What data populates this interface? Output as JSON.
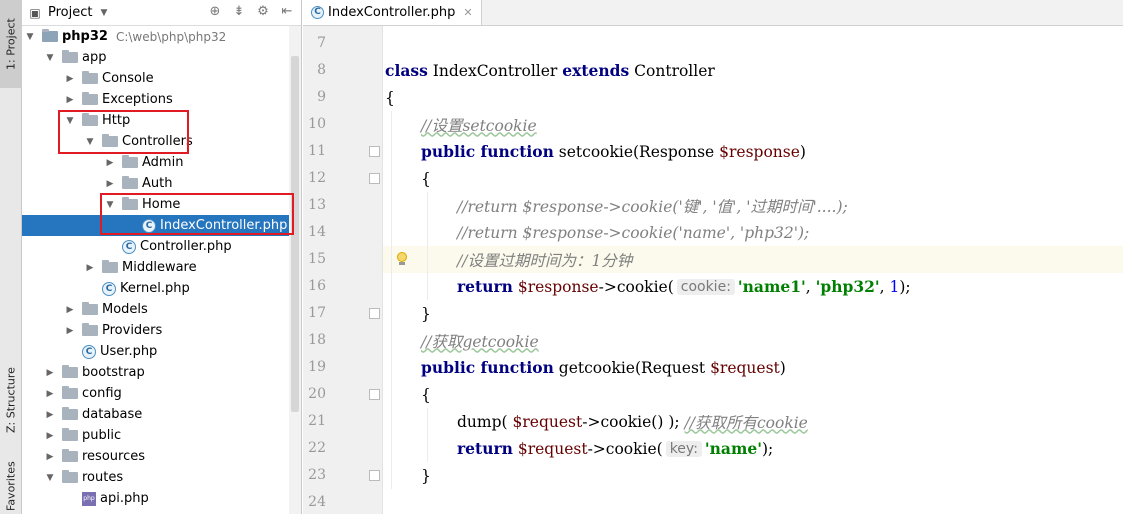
{
  "side_strip": {
    "project_tab": "1: Project",
    "structure_tab": "Z: Structure",
    "favorites_tab": "Favorites"
  },
  "project_panel": {
    "title": "Project",
    "tree": [
      {
        "label": "php32",
        "path": "C:\\web\\php\\php32",
        "depth": 0,
        "expanded": true,
        "kind": "project-folder",
        "bold": true
      },
      {
        "label": "app",
        "depth": 1,
        "expanded": true,
        "kind": "folder"
      },
      {
        "label": "Console",
        "depth": 2,
        "expanded": false,
        "kind": "folder"
      },
      {
        "label": "Exceptions",
        "depth": 2,
        "expanded": false,
        "kind": "folder"
      },
      {
        "label": "Http",
        "depth": 2,
        "expanded": true,
        "kind": "folder"
      },
      {
        "label": "Controllers",
        "depth": 3,
        "expanded": true,
        "kind": "folder"
      },
      {
        "label": "Admin",
        "depth": 4,
        "expanded": false,
        "kind": "folder"
      },
      {
        "label": "Auth",
        "depth": 4,
        "expanded": false,
        "kind": "folder"
      },
      {
        "label": "Home",
        "depth": 4,
        "expanded": true,
        "kind": "folder"
      },
      {
        "label": "IndexController.php",
        "depth": 5,
        "kind": "class",
        "selected": true
      },
      {
        "label": "Controller.php",
        "depth": 4,
        "kind": "class"
      },
      {
        "label": "Middleware",
        "depth": 3,
        "expanded": false,
        "kind": "folder"
      },
      {
        "label": "Kernel.php",
        "depth": 3,
        "kind": "class"
      },
      {
        "label": "Models",
        "depth": 2,
        "expanded": false,
        "kind": "folder"
      },
      {
        "label": "Providers",
        "depth": 2,
        "expanded": false,
        "kind": "folder"
      },
      {
        "label": "User.php",
        "depth": 2,
        "kind": "class"
      },
      {
        "label": "bootstrap",
        "depth": 1,
        "expanded": false,
        "kind": "folder"
      },
      {
        "label": "config",
        "depth": 1,
        "expanded": false,
        "kind": "folder"
      },
      {
        "label": "database",
        "depth": 1,
        "expanded": false,
        "kind": "folder"
      },
      {
        "label": "public",
        "depth": 1,
        "expanded": false,
        "kind": "folder"
      },
      {
        "label": "resources",
        "depth": 1,
        "expanded": false,
        "kind": "folder"
      },
      {
        "label": "routes",
        "depth": 1,
        "expanded": true,
        "kind": "folder"
      },
      {
        "label": "api.php",
        "depth": 2,
        "kind": "php"
      }
    ]
  },
  "editor": {
    "active_tab": "IndexController.php",
    "lines": [
      {
        "num": "7",
        "indent": 0,
        "tokens": []
      },
      {
        "num": "8",
        "indent": 0,
        "tokens": [
          [
            "kw",
            "class"
          ],
          [
            "plain",
            " IndexController "
          ],
          [
            "kw",
            "extends"
          ],
          [
            "plain",
            " Controller"
          ]
        ]
      },
      {
        "num": "9",
        "indent": 0,
        "tokens": [
          [
            "plain",
            "{"
          ]
        ]
      },
      {
        "num": "10",
        "indent": 1,
        "tokens": [
          [
            "cmt",
            "//设置setcookie"
          ]
        ]
      },
      {
        "num": "11",
        "indent": 1,
        "tokens": [
          [
            "kw",
            "public function"
          ],
          [
            "plain",
            " setcookie(Response "
          ],
          [
            "var",
            "$response"
          ],
          [
            "plain",
            ")"
          ]
        ]
      },
      {
        "num": "12",
        "indent": 1,
        "tokens": [
          [
            "plain",
            "{"
          ]
        ]
      },
      {
        "num": "13",
        "indent": 2,
        "tokens": [
          [
            "cmt",
            "//return $response->cookie('键', '值', '过期时间'....);"
          ]
        ]
      },
      {
        "num": "14",
        "indent": 2,
        "tokens": [
          [
            "cmt",
            "//return $response->cookie('name', 'php32');"
          ]
        ]
      },
      {
        "num": "15",
        "indent": 2,
        "current": true,
        "tokens": [
          [
            "cmt",
            "//设置过期时间为：1分钟"
          ]
        ]
      },
      {
        "num": "16",
        "indent": 2,
        "tokens": [
          [
            "kw",
            "return"
          ],
          [
            "plain",
            " "
          ],
          [
            "var",
            "$response"
          ],
          [
            "plain",
            "->cookie("
          ],
          [
            "hint",
            "cookie:"
          ],
          [
            "str",
            "'name1'"
          ],
          [
            "plain",
            ", "
          ],
          [
            "str",
            "'php32'"
          ],
          [
            "plain",
            ", "
          ],
          [
            "num",
            "1"
          ],
          [
            "plain",
            ");"
          ]
        ]
      },
      {
        "num": "17",
        "indent": 1,
        "tokens": [
          [
            "plain",
            "}"
          ]
        ]
      },
      {
        "num": "18",
        "indent": 1,
        "tokens": [
          [
            "cmt",
            "//获取getcookie"
          ]
        ]
      },
      {
        "num": "19",
        "indent": 1,
        "tokens": [
          [
            "kw",
            "public function"
          ],
          [
            "plain",
            " getcookie(Request "
          ],
          [
            "var",
            "$request"
          ],
          [
            "plain",
            ")"
          ]
        ]
      },
      {
        "num": "20",
        "indent": 1,
        "tokens": [
          [
            "plain",
            "{"
          ]
        ]
      },
      {
        "num": "21",
        "indent": 2,
        "tokens": [
          [
            "plain",
            "dump( "
          ],
          [
            "var",
            "$request"
          ],
          [
            "plain",
            "->cookie() ); "
          ],
          [
            "cmt",
            "//获取所有cookie"
          ]
        ]
      },
      {
        "num": "22",
        "indent": 2,
        "tokens": [
          [
            "kw",
            "return"
          ],
          [
            "plain",
            " "
          ],
          [
            "var",
            "$request"
          ],
          [
            "plain",
            "->cookie("
          ],
          [
            "hint",
            "key:"
          ],
          [
            "str",
            "'name'"
          ],
          [
            "plain",
            ");"
          ]
        ]
      },
      {
        "num": "23",
        "indent": 1,
        "tokens": [
          [
            "plain",
            "}"
          ]
        ]
      },
      {
        "num": "24",
        "indent": 0,
        "tokens": []
      }
    ]
  },
  "colors": {
    "selection": "#2675bf",
    "highlight_box": "#e01b24",
    "keyword": "#000080",
    "string": "#008000",
    "comment": "#808080",
    "variable": "#660000"
  }
}
